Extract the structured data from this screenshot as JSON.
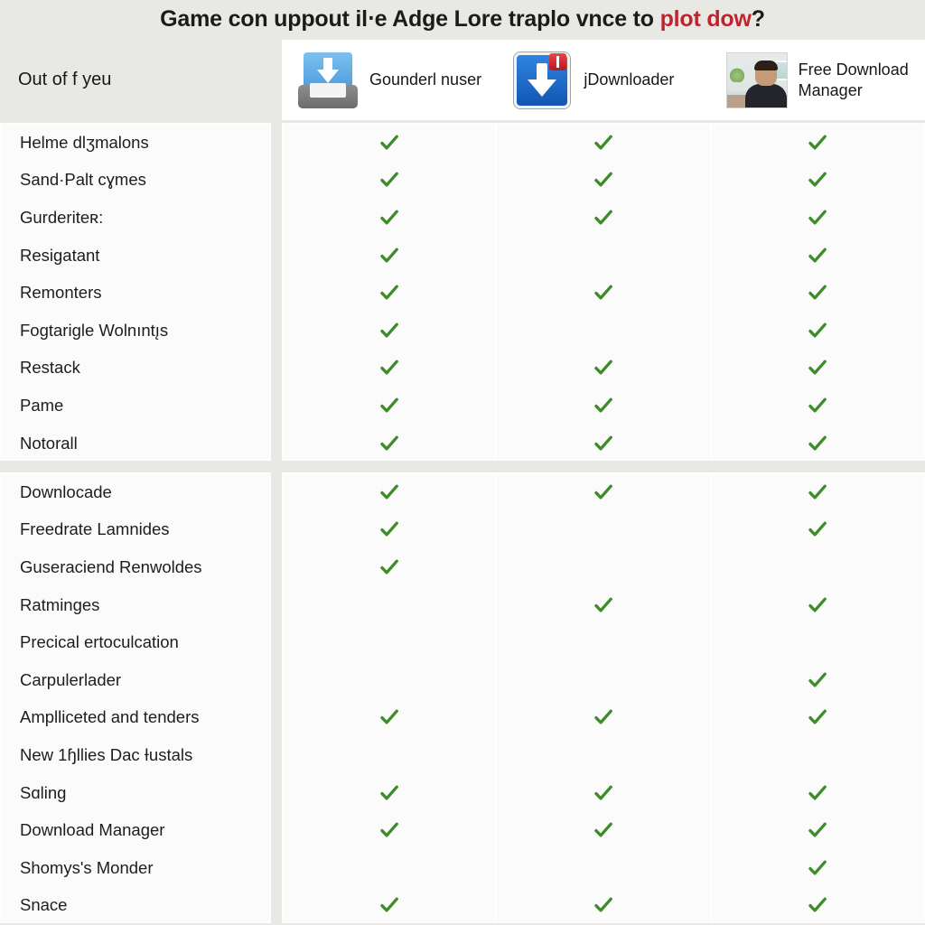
{
  "title": {
    "lead": "Game con uppout il‧e Adge Lore traplo vnce to ",
    "accent": "plot dow",
    "tail": "?"
  },
  "corner_label": "Out of f yeu",
  "columns": [
    {
      "name": "Gounderl nuser",
      "icon": "download-tray-icon"
    },
    {
      "name": "jDownloader",
      "icon": "jdownloader-icon"
    },
    {
      "name": "Free Download Manager",
      "icon": "free-download-manager-photo-icon"
    }
  ],
  "colors": {
    "page_background": "#e8e9e4",
    "card_background": "#fbfbfb",
    "check_green": "#3e8c28",
    "title_accent_red": "#c0232c",
    "title_text": "#1b1b1b"
  },
  "check_glyph": "check-icon",
  "blocks": [
    {
      "rows": [
        {
          "label": "Helme dlʒmalons",
          "checks": [
            true,
            true,
            true
          ]
        },
        {
          "label": "Sand·Palt cɣmes",
          "checks": [
            true,
            true,
            true
          ]
        },
        {
          "label": "Gurderiteʀ:",
          "checks": [
            true,
            true,
            true
          ]
        },
        {
          "label": "Resigatant",
          "checks": [
            true,
            false,
            true
          ]
        },
        {
          "label": "Remonters",
          "checks": [
            true,
            true,
            true
          ]
        },
        {
          "label": "Fogtarigle Wolnıntı̨s",
          "checks": [
            true,
            false,
            true
          ]
        },
        {
          "label": "Restack",
          "checks": [
            true,
            true,
            true
          ]
        },
        {
          "label": "Pame",
          "checks": [
            true,
            true,
            true
          ]
        },
        {
          "label": "Notorall",
          "checks": [
            true,
            true,
            true
          ]
        }
      ]
    },
    {
      "rows": [
        {
          "label": "Downlocade",
          "checks": [
            true,
            true,
            true
          ]
        },
        {
          "label": "Freedrate Lamnides",
          "checks": [
            true,
            false,
            true
          ]
        },
        {
          "label": "Guseraciend Renwoldes",
          "checks": [
            true,
            false,
            false
          ]
        },
        {
          "label": "Ratminges",
          "checks": [
            false,
            true,
            true
          ]
        },
        {
          "label": "Precical ertoculcation",
          "checks": [
            false,
            false,
            false
          ]
        },
        {
          "label": "Carpulerlader",
          "checks": [
            false,
            false,
            true
          ]
        },
        {
          "label": "Amplliceted and tenders",
          "checks": [
            true,
            true,
            true
          ]
        },
        {
          "label": "New 1ɧllies Dac Ɨustals",
          "checks": [
            false,
            false,
            false
          ]
        },
        {
          "label": "Sɑling",
          "checks": [
            true,
            true,
            true
          ]
        },
        {
          "label": " Download Manager",
          "checks": [
            true,
            true,
            true
          ]
        },
        {
          "label": "Shomys's Monder",
          "checks": [
            false,
            false,
            true
          ]
        },
        {
          "label": "Snace",
          "checks": [
            true,
            true,
            true
          ]
        }
      ]
    }
  ]
}
